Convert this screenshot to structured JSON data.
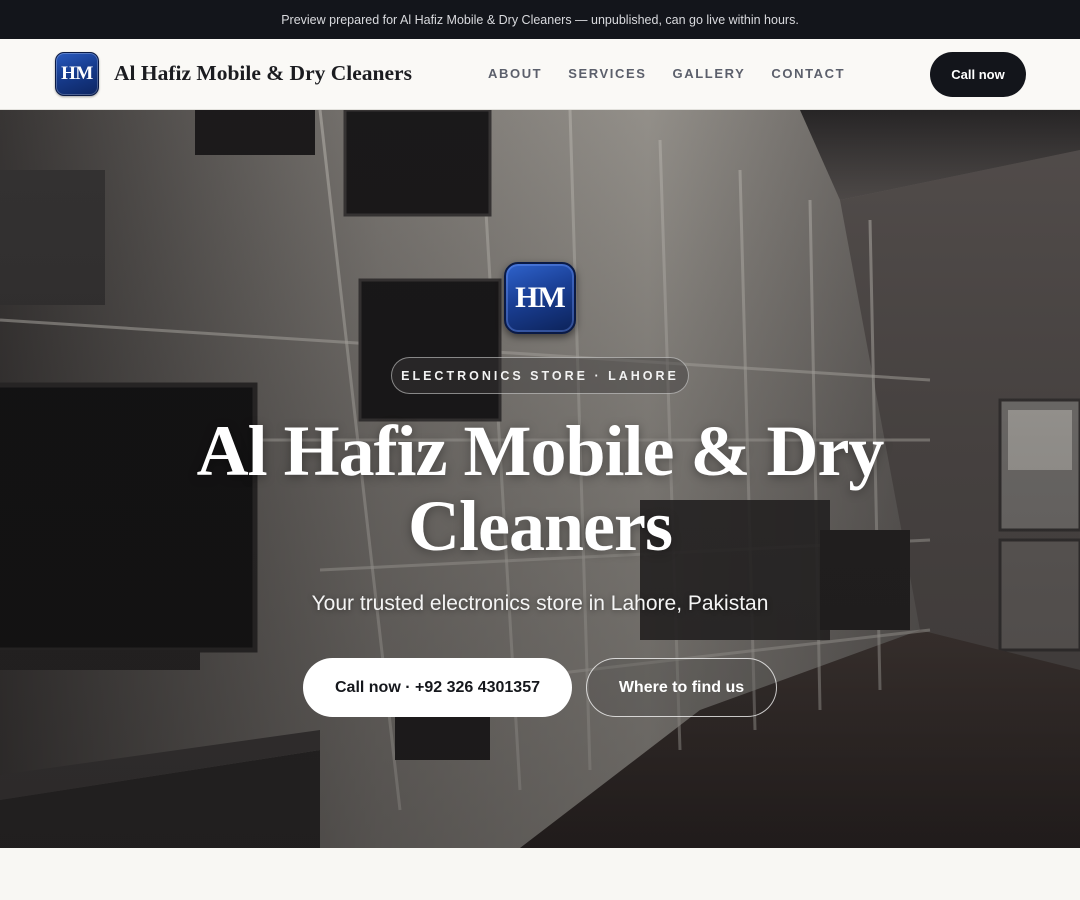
{
  "preview_banner": {
    "text": "Preview prepared for Al Hafiz Mobile & Dry Cleaners — unpublished, can go live within hours."
  },
  "navbar": {
    "logo_text": "HM",
    "brand_name": "Al Hafiz Mobile & Dry Cleaners",
    "links": [
      "ABOUT",
      "SERVICES",
      "GALLERY",
      "CONTACT"
    ],
    "cta_label": "Call now"
  },
  "hero": {
    "logo_text": "HM",
    "badge": "ELECTRONICS STORE · LAHORE",
    "title": "Al Hafiz Mobile & Dry Cleaners",
    "subtitle": "Your trusted electronics store in Lahore, Pakistan",
    "primary_button": "Call now · +92 326 4301357",
    "secondary_button": "Where to find us"
  },
  "colors": {
    "dark": "#13151b",
    "brand_blue": "#1a3f95",
    "page_bg": "#f8f7f3"
  }
}
